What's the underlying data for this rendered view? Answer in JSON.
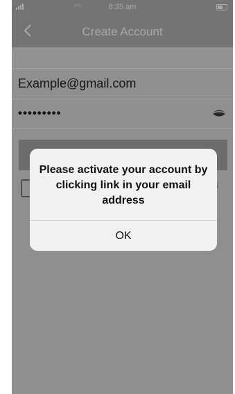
{
  "status_bar": {
    "time": "8:35 am",
    "wifi_icon": "wifi-icon",
    "signal_icon": "signal-icon",
    "battery_icon": "battery-icon"
  },
  "nav": {
    "title": "Create Account",
    "back_icon": "chevron-left-icon"
  },
  "form": {
    "email_value": "Example@gmail.com",
    "password_value": "•••••••••",
    "password_toggle_icon": "eye-icon"
  },
  "background_fragment": {
    "right_text": "s"
  },
  "alert": {
    "message": "Please activate your account by clicking link in your email address",
    "ok_label": "OK"
  },
  "colors": {
    "overlay": "#8f8f8f",
    "alert_background": "#f1f1f1",
    "text": "#111111"
  }
}
